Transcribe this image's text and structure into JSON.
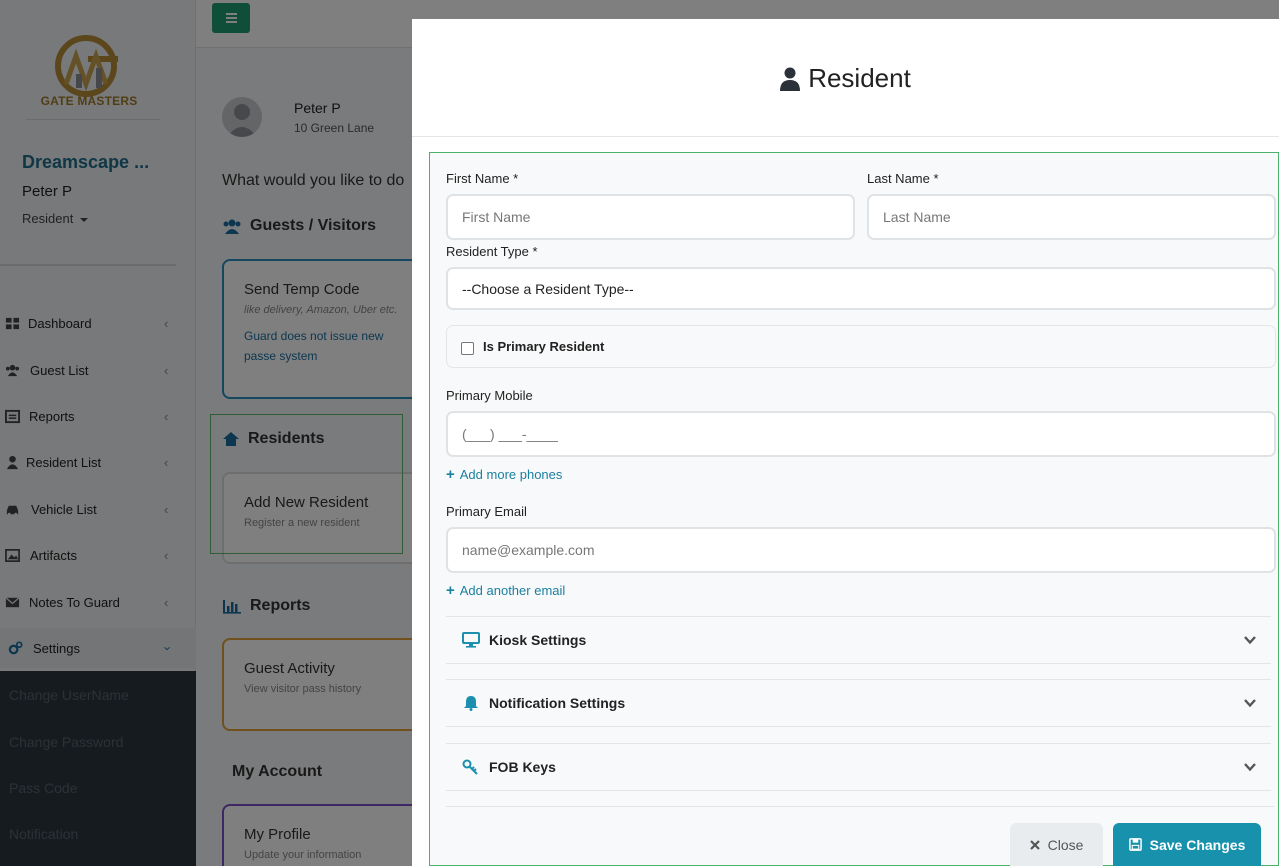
{
  "brand": {
    "logo_text": "GATE MASTERS"
  },
  "sidebar": {
    "community": "Dreamscape ...",
    "user_name": "Peter P",
    "user_role": "Resident",
    "items": [
      {
        "label": "Dashboard"
      },
      {
        "label": "Guest List"
      },
      {
        "label": "Reports"
      },
      {
        "label": "Resident List"
      },
      {
        "label": "Vehicle List"
      },
      {
        "label": "Artifacts"
      },
      {
        "label": "Notes To Guard"
      },
      {
        "label": "Settings"
      }
    ],
    "submenu": [
      "Change UserName",
      "Change Password",
      "Pass Code",
      "Notification"
    ]
  },
  "profile": {
    "name": "Peter P",
    "address": "10 Green Lane"
  },
  "main": {
    "question": "What would you like to do",
    "sections": {
      "guests": "Guests / Visitors",
      "residents": "Residents",
      "reports": "Reports",
      "account": "My Account"
    },
    "cards": {
      "temp_code": {
        "title": "Send Temp Code",
        "sub": "like delivery, Amazon, Uber etc.",
        "note": "Guard does not issue new passe system"
      },
      "add_resident": {
        "title": "Add New Resident",
        "sub": "Register a new resident"
      },
      "guest_activity": {
        "title": "Guest Activity",
        "sub": "View visitor pass history"
      },
      "my_profile": {
        "title": "My Profile",
        "sub": "Update your information"
      }
    }
  },
  "modal": {
    "title": "Resident",
    "first_name": {
      "label": "First Name *",
      "placeholder": "First Name"
    },
    "last_name": {
      "label": "Last Name *",
      "placeholder": "Last Name"
    },
    "resident_type": {
      "label": "Resident Type *",
      "value": "--Choose a Resident Type--"
    },
    "is_primary": {
      "label": "Is Primary Resident",
      "checked": false
    },
    "mobile": {
      "label": "Primary Mobile",
      "placeholder": "(___) ___-____"
    },
    "add_phones": "Add more phones",
    "email": {
      "label": "Primary Email",
      "placeholder": "name@example.com"
    },
    "add_email": "Add another email",
    "accordions": [
      "Kiosk Settings",
      "Notification Settings",
      "FOB Keys"
    ],
    "close_label": "Close",
    "save_label": "Save Changes"
  },
  "colors": {
    "accent": "#1891ad",
    "brand_green": "#1e9d73",
    "gold": "#a47d2a"
  }
}
